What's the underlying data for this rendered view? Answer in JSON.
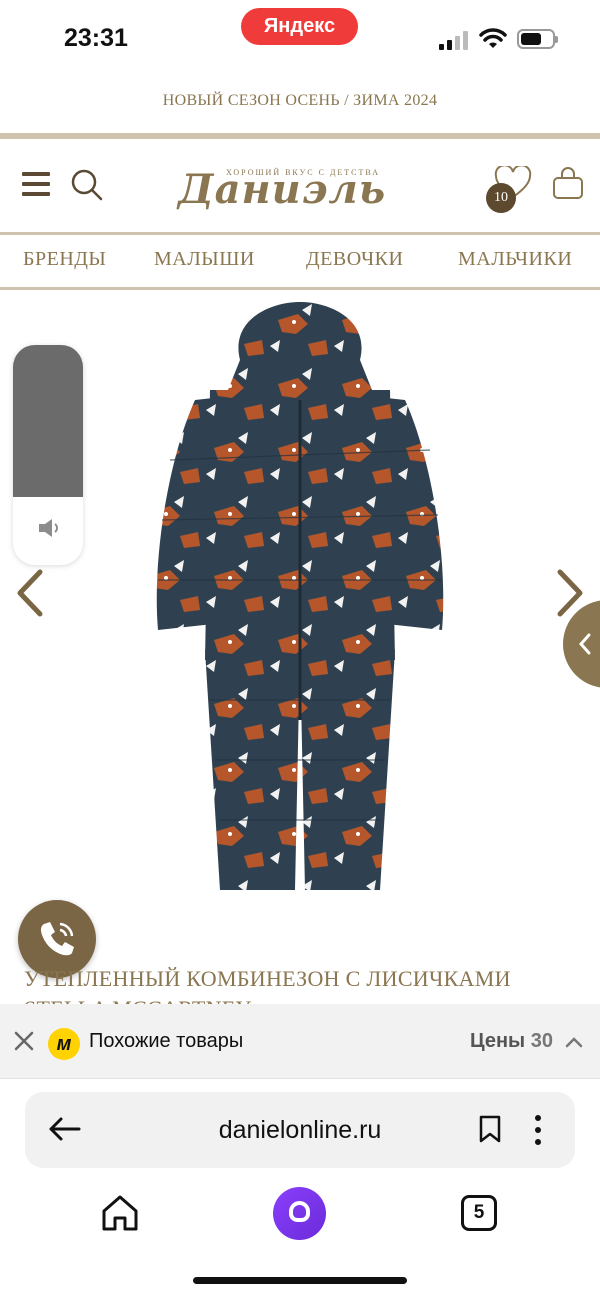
{
  "status_bar": {
    "time": "23:31",
    "browser_pill": "Яндекс"
  },
  "promo": {
    "text": "НОВЫЙ СЕЗОН ОСЕНЬ / ЗИМА 2024"
  },
  "header": {
    "logo_tagline": "ХОРОШИЙ ВКУС С ДЕТСТВА",
    "logo_text": "Даниэль",
    "wishlist_count": "10"
  },
  "nav": {
    "items": [
      "БРЕНДЫ",
      "МАЛЫШИ",
      "ДЕВОЧКИ",
      "МАЛЬЧИКИ"
    ]
  },
  "product": {
    "title": "УТЕПЛЕННЫЙ КОМБИНЕЗОН С ЛИСИЧКАМИ STELLA MCCARTNEY"
  },
  "volume": {
    "level": 0.69
  },
  "similar_bar": {
    "label": "Похожие товары",
    "prices_label": "Цены",
    "prices_count": "30",
    "market_glyph": "м"
  },
  "browser": {
    "url": "danielonline.ru",
    "tabs_count": "5"
  },
  "colors": {
    "brand": "#8a7650",
    "badge": "#5d4a2e",
    "yandex_red": "#f03b3b",
    "market_yellow": "#ffd200",
    "alice_purple": "#7b35f0"
  }
}
